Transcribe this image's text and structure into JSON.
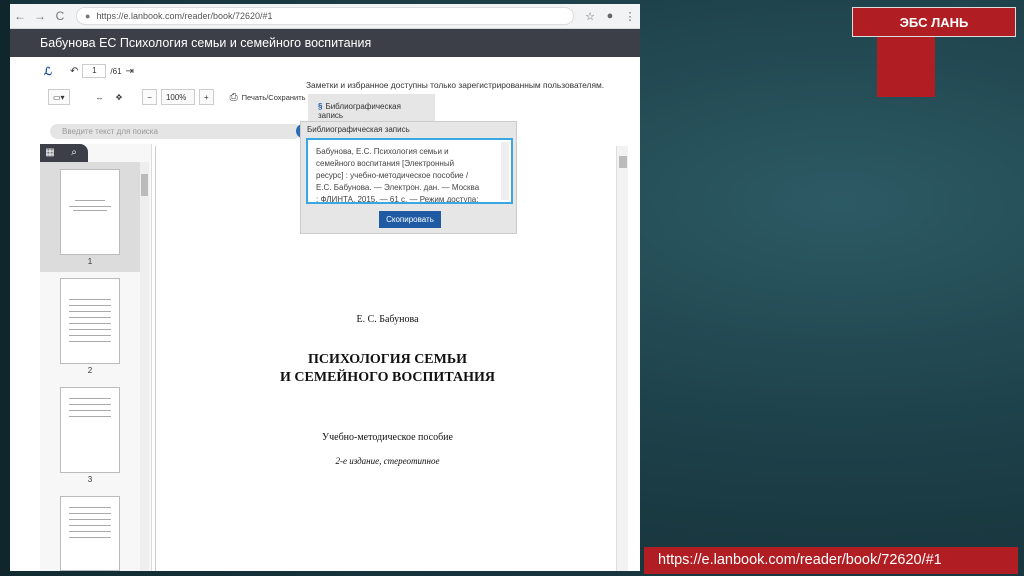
{
  "browser": {
    "url": "https://e.lanbook.com/reader/book/72620/#1",
    "back": "←",
    "forward": "→",
    "reload": "C"
  },
  "reader": {
    "title": "Бабунова ЕС Психология семьи и семейного воспитания",
    "page_current": "1",
    "page_total": "/61",
    "zoom": "100%",
    "zoom_minus": "−",
    "zoom_plus": "+",
    "print_label": "Печать/Сохранить",
    "notes_msg": "Заметки и избранное доступны только зарегистрированным пользователям.",
    "search_placeholder": "Введите текст для поиска"
  },
  "bib": {
    "tab_label": "Библиографическая запись",
    "popup_title": "Библиографическая запись",
    "text_lines": [
      "Бабунова, Е.С. Психология семьи и",
      "семейного воспитания [Электронный",
      "ресурс] : учебно-методическое пособие /",
      "Е.С. Бабунова. — Электрон. дан. — Москва",
      ": ФЛИНТА, 2015. — 61 с. — Режим доступа:"
    ],
    "copy_button": "Скопировать"
  },
  "thumbnails": [
    "1",
    "2",
    "3"
  ],
  "document": {
    "author": "Е. С. Бабунова",
    "title_line1": "ПСИХОЛОГИЯ СЕМЬИ",
    "title_line2": "И СЕМЕЙНОГО ВОСПИТАНИЯ",
    "subtitle": "Учебно-методическое пособие",
    "edition": "2-е издание, стереотипное"
  },
  "slide": {
    "badge": "ЭБС ЛАНЬ",
    "url_caption": "https://e.lanbook.com/reader/book/72620/#1"
  },
  "colors": {
    "accent_red": "#b01d22",
    "reader_dark": "#3d3f48",
    "button_blue": "#1f5aa3"
  }
}
